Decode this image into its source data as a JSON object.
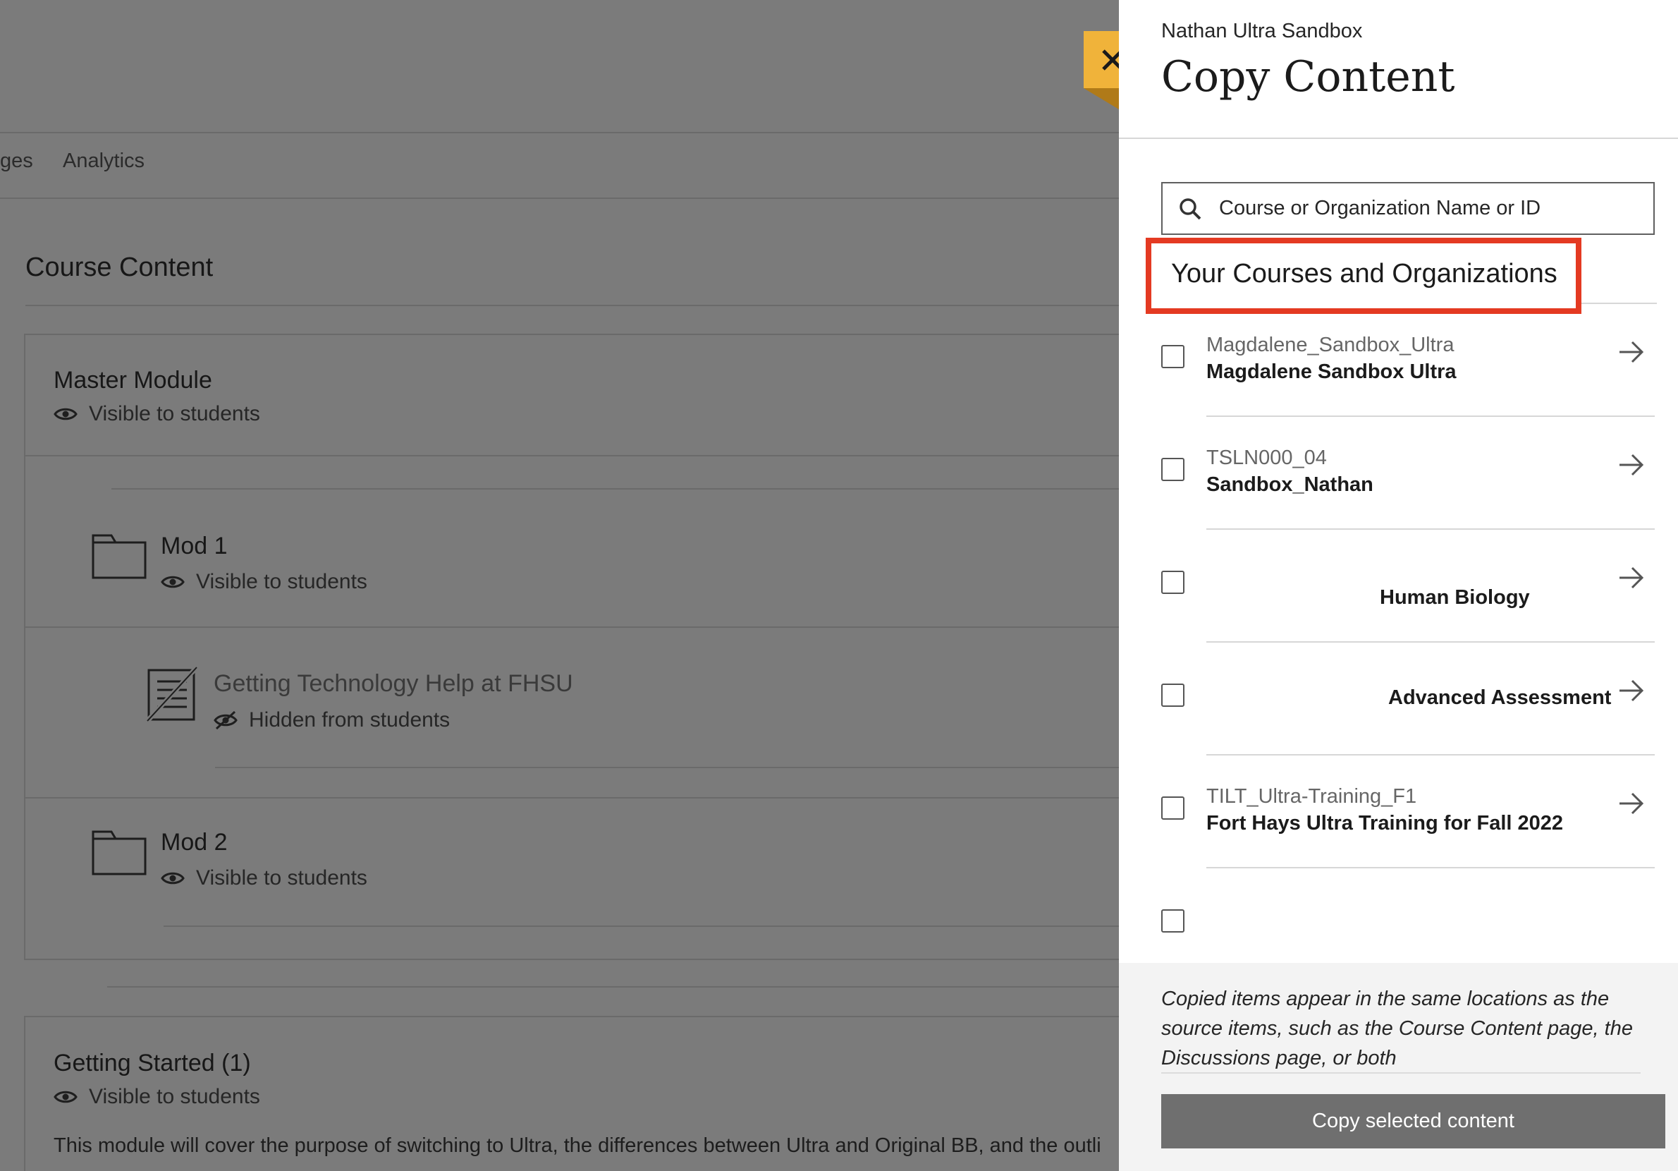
{
  "background": {
    "nav_tabs": [
      "ges",
      "Analytics"
    ],
    "section_title": "Course Content",
    "modules": [
      {
        "title": "Master Module",
        "visibility": "Visible to students"
      },
      {
        "title": "Mod 1",
        "visibility": "Visible to students"
      },
      {
        "title": "Getting Technology Help at FHSU",
        "visibility": "Hidden from students"
      },
      {
        "title": "Mod 2",
        "visibility": "Visible to students"
      },
      {
        "title": "Getting Started (1)",
        "visibility": "Visible to students"
      }
    ],
    "getting_started_description": "This module will cover the purpose of switching to Ultra, the differences between Ultra and Original BB, and the outli"
  },
  "panel": {
    "course_name": "Nathan Ultra Sandbox",
    "title": "Copy Content",
    "close_icon": "close-icon",
    "search": {
      "placeholder": "Course or Organization Name or ID",
      "icon": "search-icon"
    },
    "section_heading": "Your Courses and Organizations",
    "highlight_color": "#e43a22",
    "courses": [
      {
        "id": "Magdalene_Sandbox_Ultra",
        "name": "Magdalene Sandbox Ultra"
      },
      {
        "id": "TSLN000_04",
        "name": "Sandbox_Nathan"
      },
      {
        "id": "",
        "name": "Human Biology"
      },
      {
        "id": "",
        "name": "Advanced Assessment"
      },
      {
        "id": "TILT_Ultra-Training_F1",
        "name": "Fort Hays Ultra Training for Fall 2022"
      },
      {
        "id": "",
        "name": ""
      }
    ],
    "footer_note": "Copied items appear in the same locations as the source items, such as the Course Content page, the Discussions page, or both",
    "copy_button": "Copy selected content"
  },
  "colors": {
    "accent_close": "#f0b33a",
    "overlay": "#7b7b7b",
    "button_bg": "#6f6f6f"
  }
}
